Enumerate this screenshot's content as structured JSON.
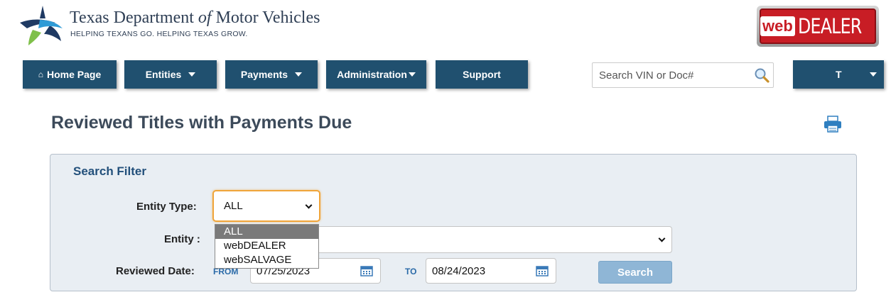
{
  "header": {
    "brand_title_part1": "Texas Department ",
    "brand_title_of": "of",
    "brand_title_part2": " Motor Vehicles",
    "tagline": "HELPING TEXANS GO. HELPING TEXAS GROW.",
    "logo_web": "web",
    "logo_dealer": "DEALER"
  },
  "nav": {
    "home": "Home Page",
    "entities": "Entities",
    "payments": "Payments",
    "administration": "Administration",
    "support": "Support",
    "user_initial": "T"
  },
  "search": {
    "placeholder": "Search VIN or Doc#"
  },
  "page": {
    "title": "Reviewed Titles with Payments Due"
  },
  "filter": {
    "title": "Search Filter",
    "entity_type_label": "Entity Type:",
    "entity_type_value": "ALL",
    "entity_type_options": [
      "ALL",
      "webDEALER",
      "webSALVAGE"
    ],
    "entity_label": "Entity :",
    "entity_value": "",
    "reviewed_date_label": "Reviewed Date:",
    "from_label": "FROM",
    "from_value": "07/25/2023",
    "to_label": "TO",
    "to_value": "08/24/2023",
    "search_button": "Search"
  },
  "colors": {
    "nav_bg": "#20506f",
    "accent_orange": "#f0a53a",
    "title_blue": "#23507b",
    "brand_red": "#c81d25"
  },
  "icons": {
    "home": "home-icon",
    "search": "search-icon",
    "print": "print-icon",
    "calendar": "calendar-icon"
  }
}
